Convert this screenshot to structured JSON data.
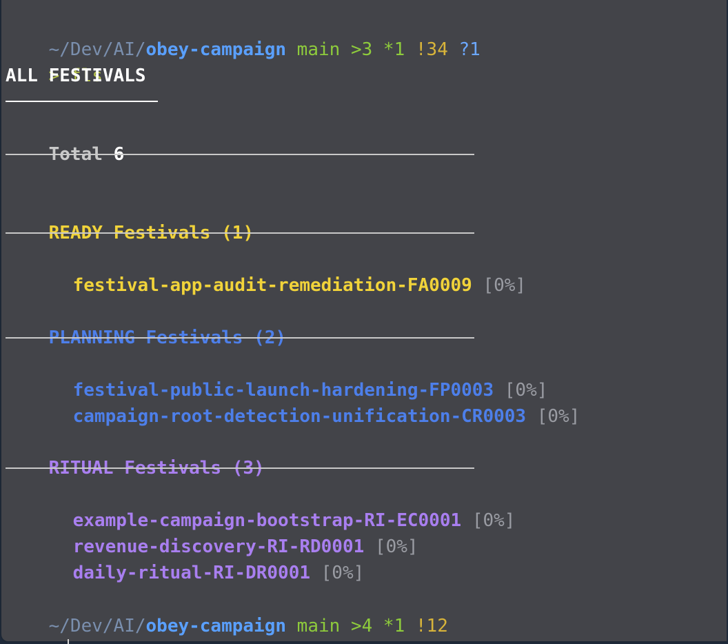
{
  "colors": {
    "path_dim": "#7a8fae",
    "repo": "#5aa0ff",
    "git_green": "#8ecb3c",
    "git_yellow": "#d8b43a",
    "git_blue": "#6ca8ff",
    "prompt": "#b5c34a",
    "ready": "#f1d33a",
    "planning": "#4d7fea",
    "ritual": "#a97ff0",
    "muted": "#9a9ca3",
    "rule": "#c9c9c9"
  },
  "prompt_top": {
    "path_prefix": "~/Dev/AI/",
    "repo": "obey-campaign",
    "branch": "main",
    "ahead": ">3",
    "staged": "*1",
    "modified": "!34",
    "untracked": "?1"
  },
  "command": {
    "symbol": ">",
    "text": "fls"
  },
  "heading": "ALL FESTIVALS",
  "total": {
    "label": "Total",
    "value": "6"
  },
  "groups": [
    {
      "status": "READY",
      "label": "Festivals",
      "count": "(1)",
      "items": [
        {
          "name": "festival-app-audit-remediation-FA0009",
          "progress": "[0%]"
        }
      ]
    },
    {
      "status": "PLANNING",
      "label": "Festivals",
      "count": "(2)",
      "items": [
        {
          "name": "festival-public-launch-hardening-FP0003",
          "progress": "[0%]"
        },
        {
          "name": "campaign-root-detection-unification-CR0003",
          "progress": "[0%]"
        }
      ]
    },
    {
      "status": "RITUAL",
      "label": "Festivals",
      "count": "(3)",
      "items": [
        {
          "name": "example-campaign-bootstrap-RI-EC0001",
          "progress": "[0%]"
        },
        {
          "name": "revenue-discovery-RI-RD0001",
          "progress": "[0%]"
        },
        {
          "name": "daily-ritual-RI-DR0001",
          "progress": "[0%]"
        }
      ]
    }
  ],
  "prompt_bottom": {
    "path_prefix": "~/Dev/AI/",
    "repo": "obey-campaign",
    "branch": "main",
    "ahead": ">4",
    "staged": "*1",
    "modified": "!12"
  },
  "input_prompt": {
    "symbol": ">"
  }
}
